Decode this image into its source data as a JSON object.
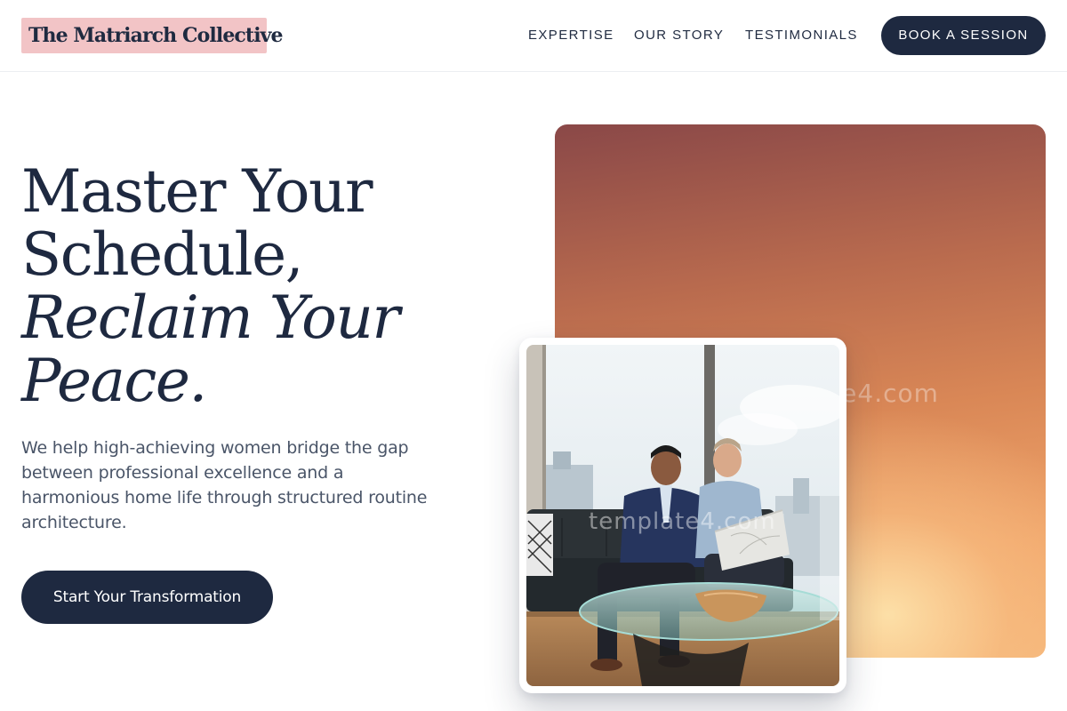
{
  "brand": {
    "name": "The Matriarch Collective",
    "accent": "#f2c4c6",
    "navy": "#1e2940"
  },
  "nav": {
    "items": [
      {
        "label": "EXPERTISE"
      },
      {
        "label": "OUR STORY"
      },
      {
        "label": "TESTIMONIALS"
      }
    ],
    "cta_label": "BOOK A SESSION"
  },
  "hero": {
    "headline": {
      "line1": "Master Your",
      "line2": "Schedule,",
      "line3": "Reclaim Your",
      "line4": "Peace."
    },
    "lead": "We help high-achieving women bridge the gap between professional excellence and a harmonious home life through structured routine architecture.",
    "cta_label": "Start Your Transformation"
  },
  "media": {
    "watermark_panel": "template4.com",
    "watermark_photo": "template4.com",
    "gradient_colors": [
      "#8a4848",
      "#d98756",
      "#f5b67a"
    ]
  },
  "icons": {
    "photo": "business-meeting-photo"
  }
}
